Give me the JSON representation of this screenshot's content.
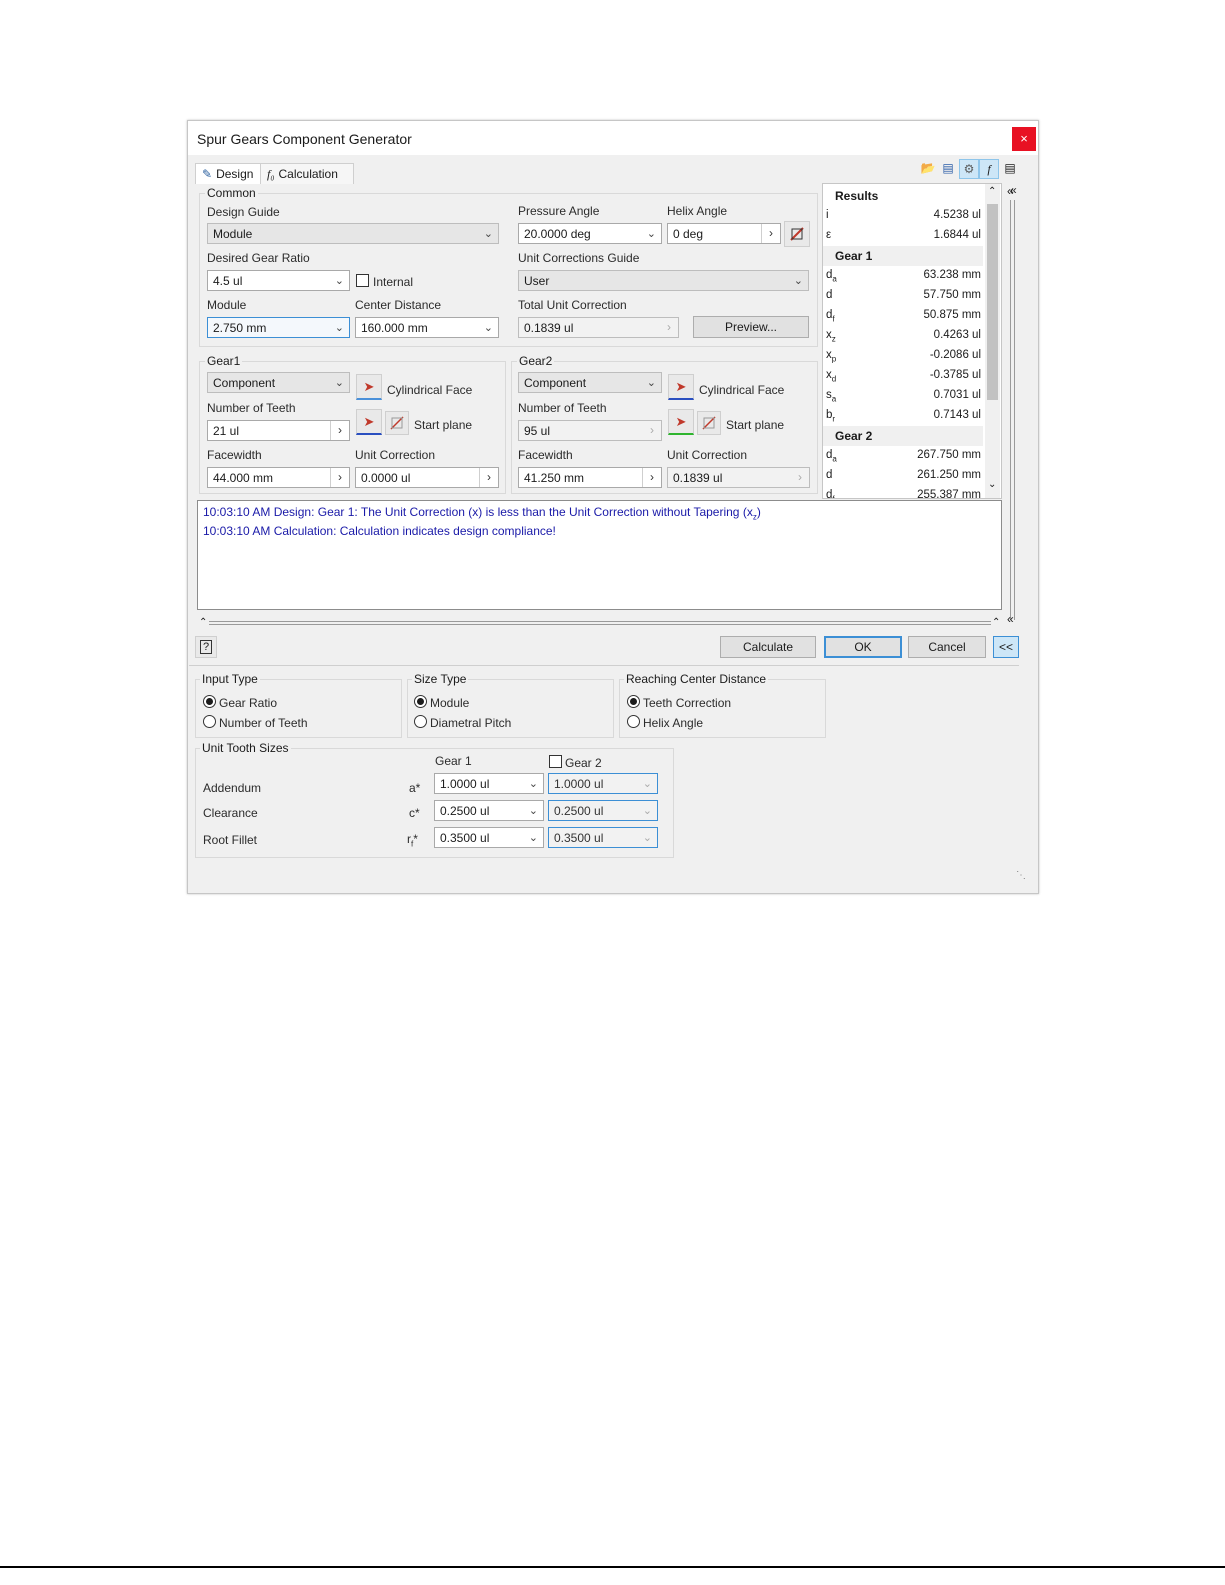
{
  "window": {
    "title": "Spur Gears Component Generator",
    "close_glyph": "×"
  },
  "tabs": [
    {
      "label": "Design"
    },
    {
      "label": "Calculation"
    }
  ],
  "common": {
    "group_label": "Common",
    "design_guide": {
      "label": "Design Guide",
      "value": "Module"
    },
    "pressure_angle": {
      "label": "Pressure Angle",
      "value": "20.0000 deg"
    },
    "helix_angle": {
      "label": "Helix Angle",
      "value": "0 deg"
    },
    "gear_ratio": {
      "label": "Desired Gear Ratio",
      "value": "4.5 ul"
    },
    "internal": {
      "label": "Internal",
      "checked": false
    },
    "unit_corrections_guide": {
      "label": "Unit Corrections Guide",
      "value": "User"
    },
    "module": {
      "label": "Module",
      "value": "2.750 mm"
    },
    "center_distance": {
      "label": "Center Distance",
      "value": "160.000 mm"
    },
    "total_unit_correction": {
      "label": "Total Unit Correction",
      "value": "0.1839 ul"
    },
    "preview_label": "Preview..."
  },
  "gear1": {
    "group_label": "Gear1",
    "type": "Component",
    "cylindrical_face": "Cylindrical Face",
    "teeth_label": "Number of Teeth",
    "teeth": "21 ul",
    "start_plane": "Start plane",
    "facewidth_label": "Facewidth",
    "facewidth": "44.000 mm",
    "unit_correction_label": "Unit Correction",
    "unit_correction": "0.0000 ul"
  },
  "gear2": {
    "group_label": "Gear2",
    "type": "Component",
    "cylindrical_face": "Cylindrical Face",
    "teeth_label": "Number of Teeth",
    "teeth": "95 ul",
    "start_plane": "Start plane",
    "facewidth_label": "Facewidth",
    "facewidth": "41.250 mm",
    "unit_correction_label": "Unit Correction",
    "unit_correction": "0.1839 ul"
  },
  "results": {
    "title": "Results",
    "general": [
      {
        "sym": "i",
        "value": "4.5238 ul"
      },
      {
        "sym": "ε",
        "value": "1.6844 ul"
      }
    ],
    "gear1_label": "Gear 1",
    "gear1": [
      {
        "sym": "d",
        "sub": "a",
        "value": "63.238 mm"
      },
      {
        "sym": "d",
        "sub": "",
        "value": "57.750 mm"
      },
      {
        "sym": "d",
        "sub": "f",
        "value": "50.875 mm"
      },
      {
        "sym": "x",
        "sub": "z",
        "value": "0.4263 ul"
      },
      {
        "sym": "x",
        "sub": "p",
        "value": "-0.2086 ul"
      },
      {
        "sym": "x",
        "sub": "d",
        "value": "-0.3785 ul"
      },
      {
        "sym": "s",
        "sub": "a",
        "value": "0.7031 ul"
      },
      {
        "sym": "b",
        "sub": "r",
        "value": "0.7143 ul"
      }
    ],
    "gear2_label": "Gear 2",
    "gear2": [
      {
        "sym": "d",
        "sub": "a",
        "value": "267.750 mm"
      },
      {
        "sym": "d",
        "sub": "",
        "value": "261.250 mm"
      },
      {
        "sym": "d",
        "sub": "f",
        "value": "255.387 mm"
      }
    ]
  },
  "messages": [
    {
      "text": "10:03:10 AM Design: Gear 1: The Unit Correction (x) is less than the Unit Correction without Tapering (x",
      "sub": "z",
      "tail": ")"
    },
    {
      "text": "10:03:10 AM Calculation: Calculation indicates design compliance!"
    }
  ],
  "buttons": {
    "help": "?",
    "calculate": "Calculate",
    "ok": "OK",
    "cancel": "Cancel",
    "collapse": "<<"
  },
  "input_type": {
    "label": "Input Type",
    "options": [
      "Gear Ratio",
      "Number of Teeth"
    ],
    "selected": 0
  },
  "size_type": {
    "label": "Size Type",
    "options": [
      "Module",
      "Diametral Pitch"
    ],
    "selected": 0
  },
  "reaching_center_distance": {
    "label": "Reaching Center Distance",
    "options": [
      "Teeth Correction",
      "Helix Angle"
    ],
    "selected": 0
  },
  "unit_tooth_sizes": {
    "label": "Unit Tooth Sizes",
    "gear1_header": "Gear 1",
    "gear2_header": "Gear 2",
    "gear2_checked": false,
    "rows": [
      {
        "name": "Addendum",
        "sym": "a*",
        "sub": "",
        "gear1": "1.0000 ul",
        "gear2": "1.0000 ul"
      },
      {
        "name": "Clearance",
        "sym": "c*",
        "sub": "",
        "gear1": "0.2500 ul",
        "gear2": "0.2500 ul"
      },
      {
        "name": "Root Fillet",
        "sym": "r",
        "sub": "f",
        "sym_tail": "*",
        "gear1": "0.3500 ul",
        "gear2": "0.3500 ul"
      }
    ]
  },
  "colors": {
    "accent": "#3c8fd5",
    "close": "#e81123",
    "message_text": "#1a1aa8",
    "pick_arrow": "#c0392b"
  },
  "icons": [
    "design-tab-icon",
    "calculation-tab-icon",
    "open-icon",
    "save-icon",
    "options-icon",
    "formula-icon",
    "report-icon",
    "pick-arrow-icon",
    "flip-icon",
    "expand-arrows-icon",
    "help-icon",
    "resize-grip-icon"
  ]
}
